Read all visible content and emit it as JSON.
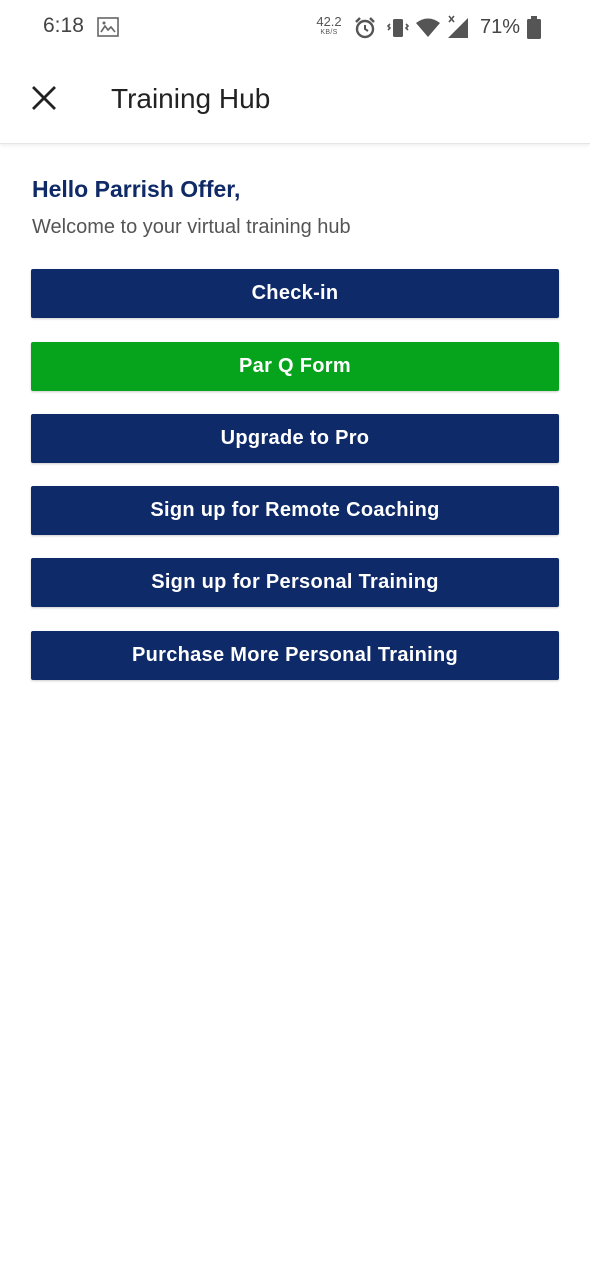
{
  "status_bar": {
    "time": "6:18",
    "net_speed": "42.2",
    "net_speed_unit": "KB/S",
    "battery": "71%"
  },
  "app_bar": {
    "title": "Training Hub",
    "close_icon": "close-icon"
  },
  "main": {
    "greeting": "Hello Parrish Offer,",
    "welcome": "Welcome to your virtual training hub",
    "buttons": [
      {
        "label": "Check-in"
      },
      {
        "label": "Par Q Form"
      },
      {
        "label": "Upgrade to Pro"
      },
      {
        "label": "Sign up for Remote Coaching"
      },
      {
        "label": "Sign up for Personal Training"
      },
      {
        "label": "Purchase More Personal Training"
      }
    ]
  },
  "colors": {
    "primary_navy": "#0f2a68",
    "accent_green": "#06a31c",
    "greeting_text": "#0f2a66"
  }
}
